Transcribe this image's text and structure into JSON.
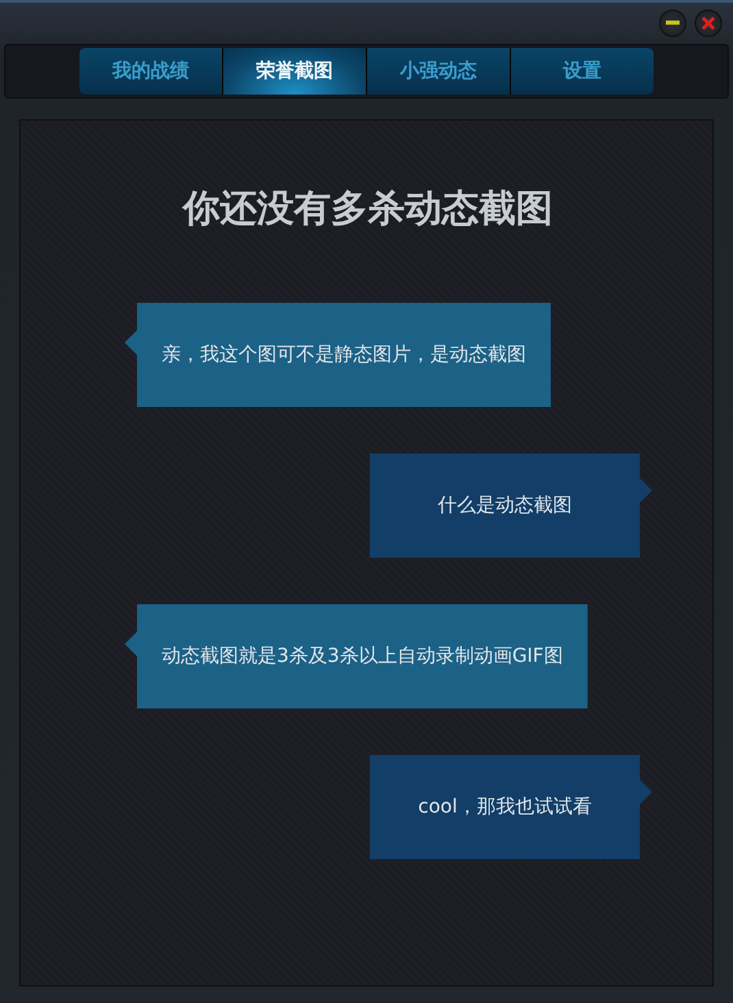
{
  "window": {
    "controls": [
      {
        "kind": "minimize"
      },
      {
        "kind": "close"
      }
    ]
  },
  "tabs": [
    {
      "label": "我的战绩",
      "selected": false
    },
    {
      "label": "荣誉截图",
      "selected": true
    },
    {
      "label": "小强动态",
      "selected": false
    },
    {
      "label": "设置",
      "selected": false
    }
  ],
  "content": {
    "title": "你还没有多杀动态截图",
    "messages": [
      {
        "kind": "received",
        "text": "亲，我这个图可不是静态图片，是动态截图"
      },
      {
        "kind": "sent",
        "text": "什么是动态截图"
      },
      {
        "kind": "received",
        "text": "动态截图就是3杀及3杀以上自动录制动画GIF图"
      },
      {
        "kind": "sent",
        "text": "cool，那我也试试看"
      }
    ]
  }
}
